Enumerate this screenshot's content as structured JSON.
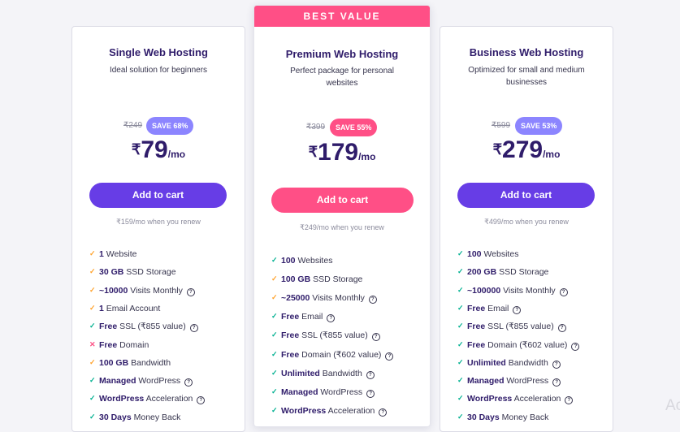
{
  "plans": [
    {
      "title": "Single Web Hosting",
      "subtitle": "Ideal solution for beginners",
      "old_price": "₹249",
      "save_badge": "SAVE 68%",
      "currency": "₹",
      "price": "79",
      "per": "/mo",
      "cta": "Add to cart",
      "renew": "₹159/mo when you renew",
      "features": [
        {
          "mark": "check",
          "color": "orange",
          "bold": "1",
          "text": " Website",
          "help": false
        },
        {
          "mark": "check",
          "color": "orange",
          "bold": "30 GB",
          "text": " SSD Storage",
          "help": false
        },
        {
          "mark": "check",
          "color": "orange",
          "bold": "~10000",
          "text": " Visits Monthly",
          "help": true
        },
        {
          "mark": "check",
          "color": "orange",
          "bold": "1",
          "text": " Email Account",
          "help": false
        },
        {
          "mark": "check",
          "color": "green",
          "bold": "Free",
          "text": " SSL (₹855 value)",
          "help": true
        },
        {
          "mark": "cross",
          "color": "red",
          "bold": "Free",
          "text": " Domain",
          "help": false
        },
        {
          "mark": "check",
          "color": "orange",
          "bold": "100 GB",
          "text": " Bandwidth",
          "help": false
        },
        {
          "mark": "check",
          "color": "green",
          "bold": "Managed",
          "text": " WordPress",
          "help": true
        },
        {
          "mark": "check",
          "color": "green",
          "bold": "WordPress",
          "text": " Acceleration",
          "help": true
        },
        {
          "mark": "check",
          "color": "green",
          "bold": "30 Days",
          "text": " Money Back",
          "help": false
        }
      ]
    },
    {
      "ribbon": "BEST VALUE",
      "title": "Premium Web Hosting",
      "subtitle": "Perfect package for personal websites",
      "old_price": "₹399",
      "save_badge": "SAVE 55%",
      "currency": "₹",
      "price": "179",
      "per": "/mo",
      "cta": "Add to cart",
      "renew": "₹249/mo when you renew",
      "features": [
        {
          "mark": "check",
          "color": "green",
          "bold": "100",
          "text": " Websites",
          "help": false
        },
        {
          "mark": "check",
          "color": "orange",
          "bold": "100 GB",
          "text": " SSD Storage",
          "help": false
        },
        {
          "mark": "check",
          "color": "orange",
          "bold": "~25000",
          "text": " Visits Monthly",
          "help": true
        },
        {
          "mark": "check",
          "color": "green",
          "bold": "Free",
          "text": " Email",
          "help": true
        },
        {
          "mark": "check",
          "color": "green",
          "bold": "Free",
          "text": " SSL (₹855 value)",
          "help": true
        },
        {
          "mark": "check",
          "color": "green",
          "bold": "Free",
          "text": " Domain (₹602 value)",
          "help": true
        },
        {
          "mark": "check",
          "color": "green",
          "bold": "Unlimited",
          "text": " Bandwidth",
          "help": true
        },
        {
          "mark": "check",
          "color": "green",
          "bold": "Managed",
          "text": " WordPress",
          "help": true
        },
        {
          "mark": "check",
          "color": "green",
          "bold": "WordPress",
          "text": " Acceleration",
          "help": true
        }
      ]
    },
    {
      "title": "Business Web Hosting",
      "subtitle": "Optimized for small and medium businesses",
      "old_price": "₹599",
      "save_badge": "SAVE 53%",
      "currency": "₹",
      "price": "279",
      "per": "/mo",
      "cta": "Add to cart",
      "renew": "₹499/mo when you renew",
      "features": [
        {
          "mark": "check",
          "color": "green",
          "bold": "100",
          "text": " Websites",
          "help": false
        },
        {
          "mark": "check",
          "color": "green",
          "bold": "200 GB",
          "text": " SSD Storage",
          "help": false
        },
        {
          "mark": "check",
          "color": "green",
          "bold": "~100000",
          "text": " Visits Monthly",
          "help": true
        },
        {
          "mark": "check",
          "color": "green",
          "bold": "Free",
          "text": " Email",
          "help": true
        },
        {
          "mark": "check",
          "color": "green",
          "bold": "Free",
          "text": " SSL (₹855 value)",
          "help": true
        },
        {
          "mark": "check",
          "color": "green",
          "bold": "Free",
          "text": " Domain (₹602 value)",
          "help": true
        },
        {
          "mark": "check",
          "color": "green",
          "bold": "Unlimited",
          "text": " Bandwidth",
          "help": true
        },
        {
          "mark": "check",
          "color": "green",
          "bold": "Managed",
          "text": " WordPress",
          "help": true
        },
        {
          "mark": "check",
          "color": "green",
          "bold": "WordPress",
          "text": " Acceleration",
          "help": true
        },
        {
          "mark": "check",
          "color": "green",
          "bold": "30 Days",
          "text": " Money Back",
          "help": false
        }
      ]
    }
  ],
  "colors": {
    "primary_purple": "#673de6",
    "accent_pink": "#ff4f86",
    "save_purple": "#8c85ff",
    "heading": "#2f1c6a",
    "check_green": "#00b090",
    "check_orange": "#ffa22b"
  },
  "overlay_text": "Ac"
}
